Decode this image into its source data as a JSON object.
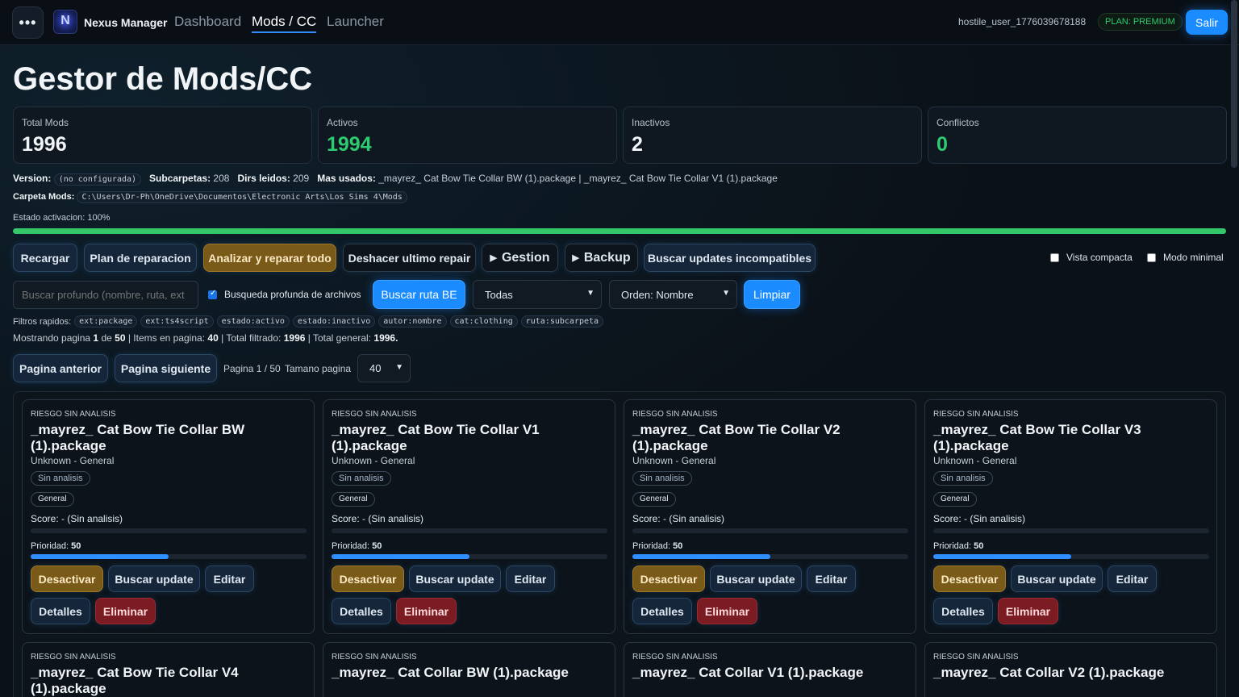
{
  "topbar": {
    "menu_label": "•••",
    "brand": "Nexus Manager",
    "nav": [
      "Dashboard",
      "Mods / CC",
      "Launcher"
    ],
    "user": "hostile_user_1776039678188",
    "plan": "PLAN: PREMIUM",
    "logout": "Salir"
  },
  "page": {
    "title": "Gestor de Mods/CC"
  },
  "stats": [
    {
      "label": "Total Mods",
      "value": "1996"
    },
    {
      "label": "Activos",
      "value": "1994"
    },
    {
      "label": "Inactivos",
      "value": "2"
    },
    {
      "label": "Conflictos",
      "value": "0"
    }
  ],
  "info": {
    "version_label": "Version:",
    "version_value": "(no configurada)",
    "subfolders_label": "Subcarpetas:",
    "subfolders_value": "208",
    "dirs_label": "Dirs leidos:",
    "dirs_value": "209",
    "most_used_label": "Mas usados:",
    "most_used_value": "_mayrez_ Cat Bow Tie Collar BW (1).package | _mayrez_ Cat Bow Tie Collar V1 (1).package",
    "folder_label": "Carpeta Mods:",
    "folder_value": "C:\\Users\\Dr-Ph\\OneDrive\\Documentos\\Electronic Arts\\Los Sims 4\\Mods",
    "activation_label": "Estado activacion: 100%",
    "activation_fraction": 1.0
  },
  "toolbar": {
    "reload": "Recargar",
    "repair_plan": "Plan de reparacion",
    "analyze": "Analizar y reparar todo",
    "undo": "Deshacer ultimo repair",
    "gestion": "Gestion",
    "backup": "Backup",
    "updates": "Buscar updates incompatibles",
    "compact": "Vista compacta",
    "minimal": "Modo minimal"
  },
  "search": {
    "placeholder": "Buscar profundo (nombre, ruta, ext",
    "deep_label": "Busqueda profunda de archivos",
    "search_be": "Buscar ruta BE",
    "filter_select": "Todas",
    "order_select": "Orden: Nombre",
    "clear": "Limpiar"
  },
  "quick_filters": {
    "label": "Filtros rapidos:",
    "items": [
      "ext:package",
      "ext:ts4script",
      "estado:activo",
      "estado:inactivo",
      "autor:nombre",
      "cat:clothing",
      "ruta:subcarpeta"
    ]
  },
  "summary": {
    "prefix": "Mostrando pagina",
    "page": "1",
    "of": "de",
    "total_pages": "50",
    "items_label": "| Items en pagina:",
    "items": "40",
    "filtered_label": "| Total filtrado:",
    "filtered": "1996",
    "general_label": "| Total general:",
    "general": "1996."
  },
  "pagination": {
    "prev": "Pagina anterior",
    "next": "Pagina siguiente",
    "page_text": "Pagina 1 / 50",
    "size_label": "Tamano pagina",
    "size_value": "40"
  },
  "cards": [
    {
      "risk": "RIESGO SIN ANALISIS",
      "name": "_mayrez_ Cat Bow Tie Collar BW (1).package",
      "sub": "Unknown - General",
      "tag1": "Sin analisis",
      "tag2": "General",
      "score": "Score: - (Sin analisis)",
      "priority_label": "Prioridad:",
      "priority": "50",
      "priority_fraction": 0.5
    },
    {
      "risk": "RIESGO SIN ANALISIS",
      "name": "_mayrez_ Cat Bow Tie Collar V1 (1).package",
      "sub": "Unknown - General",
      "tag1": "Sin analisis",
      "tag2": "General",
      "score": "Score: - (Sin analisis)",
      "priority_label": "Prioridad:",
      "priority": "50",
      "priority_fraction": 0.5
    },
    {
      "risk": "RIESGO SIN ANALISIS",
      "name": "_mayrez_ Cat Bow Tie Collar V2 (1).package",
      "sub": "Unknown - General",
      "tag1": "Sin analisis",
      "tag2": "General",
      "score": "Score: - (Sin analisis)",
      "priority_label": "Prioridad:",
      "priority": "50",
      "priority_fraction": 0.5
    },
    {
      "risk": "RIESGO SIN ANALISIS",
      "name": "_mayrez_ Cat Bow Tie Collar V3 (1).package",
      "sub": "Unknown - General",
      "tag1": "Sin analisis",
      "tag2": "General",
      "score": "Score: - (Sin analisis)",
      "priority_label": "Prioridad:",
      "priority": "50",
      "priority_fraction": 0.5
    }
  ],
  "card_actions": {
    "deactivate": "Desactivar",
    "update": "Buscar update",
    "edit": "Editar",
    "details": "Detalles",
    "delete": "Eliminar"
  },
  "cards_row2": [
    {
      "risk": "RIESGO SIN ANALISIS",
      "name": "_mayrez_ Cat Bow Tie Collar V4 (1).package"
    },
    {
      "risk": "RIESGO SIN ANALISIS",
      "name": "_mayrez_ Cat Collar BW (1).package"
    },
    {
      "risk": "RIESGO SIN ANALISIS",
      "name": "_mayrez_ Cat Collar V1 (1).package"
    },
    {
      "risk": "RIESGO SIN ANALISIS",
      "name": "_mayrez_ Cat Collar V2 (1).package"
    }
  ],
  "colors": {
    "accent": "#1a8cff",
    "success": "#2ecc71",
    "warning": "#7a5a18",
    "danger": "#7a1c22"
  }
}
